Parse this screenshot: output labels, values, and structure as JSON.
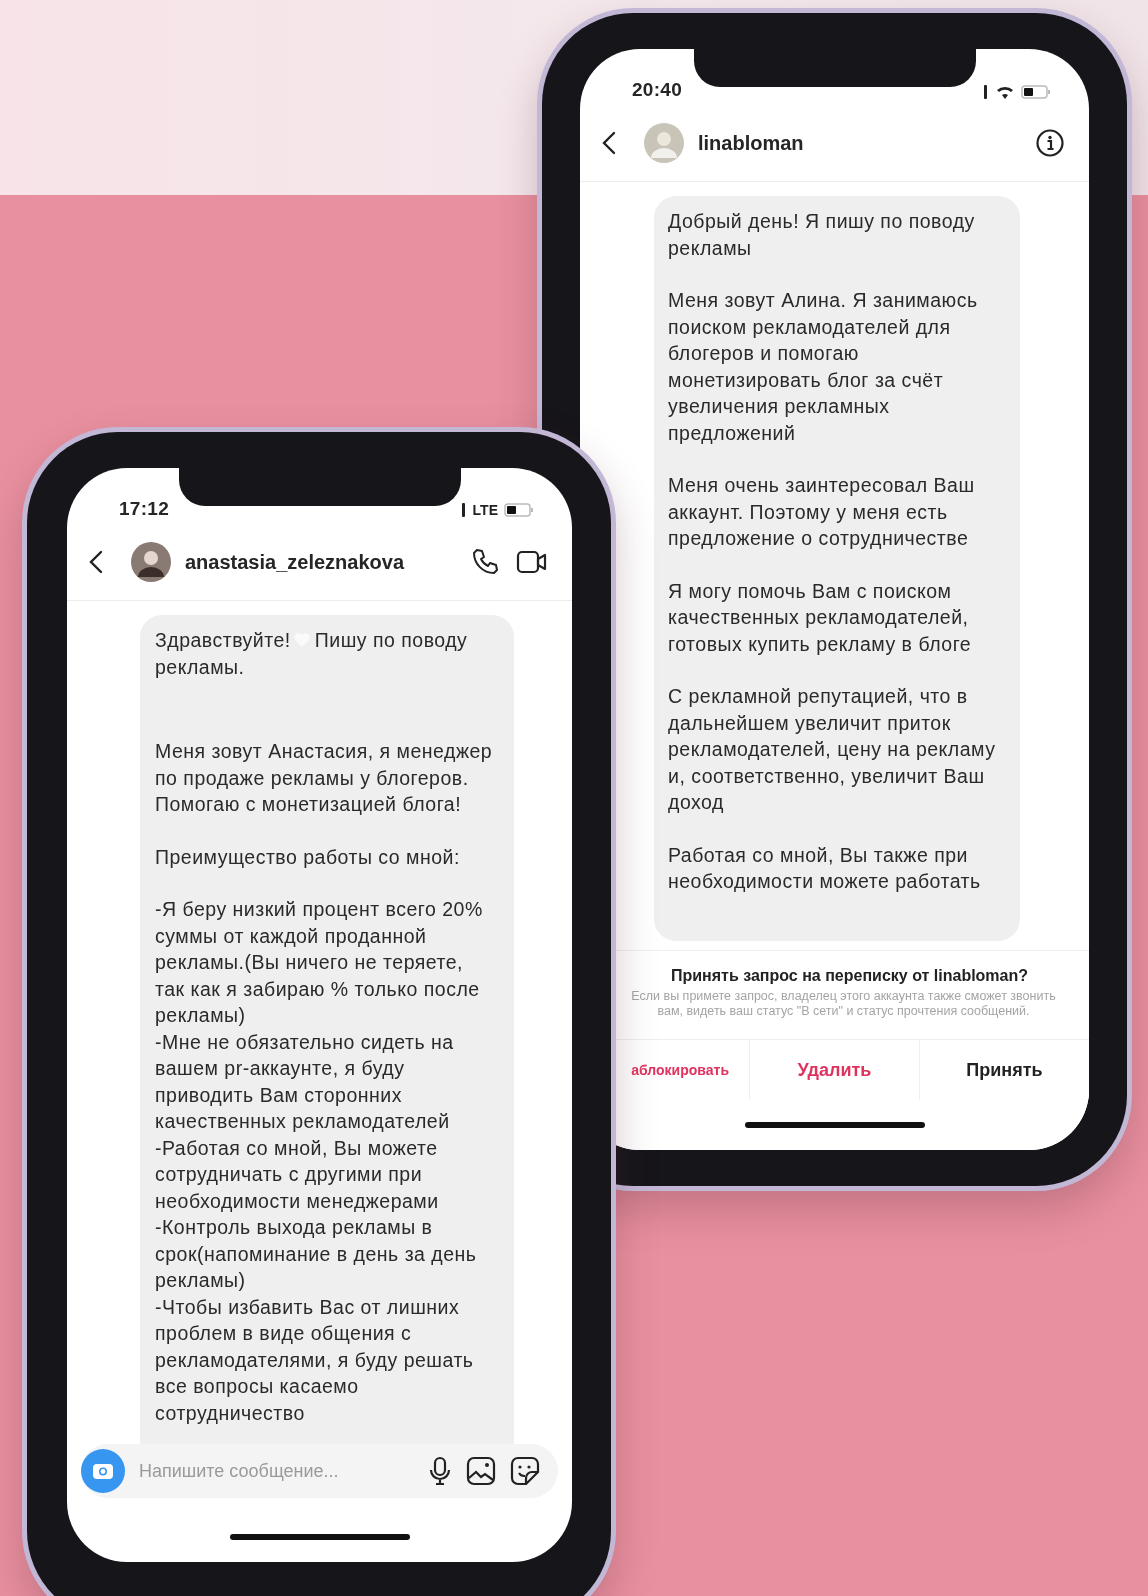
{
  "phone_back": {
    "status_bar": {
      "time": "20:40"
    },
    "header": {
      "username": "linabloman"
    },
    "message": {
      "paragraphs": [
        {
          "kind": "text",
          "text": "Добрый день! Я пишу по поводу рекламы"
        },
        {
          "kind": "text",
          "text": "Меня зовут Алина. Я занимаюсь поиском рекламодателей для блогеров и помогаю монетизировать блог за счёт увеличения рекламных предложений"
        },
        {
          "kind": "text",
          "text": "Меня очень заинтересовал Ваш аккаунт. Поэтому у меня есть предложение о сотрудничестве"
        },
        {
          "kind": "text",
          "text": "Я могу помочь Вам с поиском качественных рекламодателей, готовых купить рекламу в блоге"
        },
        {
          "kind": "text",
          "text": "С рекламной репутацией, что в дальнейшем увеличит приток рекламодателей, цену на рекламу и, соответственно, увеличит Ваш доход"
        },
        {
          "kind": "text",
          "text": "Работая со мной, Вы также при необходимости можете работать"
        }
      ]
    },
    "request_panel": {
      "title": "Принять запрос на переписку от linabloman?",
      "text": "Если вы примете запрос, владелец этого аккаунта также сможет звонить вам, видеть ваш статус \"В сети\" и статус прочтения сообщений.",
      "actions": [
        {
          "label": "аблокировать",
          "kind": "danger"
        },
        {
          "label": "Удалить",
          "kind": "danger"
        },
        {
          "label": "Принять",
          "kind": "normal"
        }
      ]
    }
  },
  "phone_front": {
    "status_bar": {
      "time": "17:12",
      "network": "LTE"
    },
    "header": {
      "username": "anastasia_zeleznakova"
    },
    "message": {
      "paragraphs": [
        {
          "kind": "icon_split",
          "before": "Здравствуйте!",
          "after": "Пишу по поводу",
          "continuation": "рекламы."
        },
        {
          "kind": "text",
          "text": "Меня зовут Анастасия, я менеджер по продаже рекламы у блогеров.\nПомогаю с монетизацией блога!"
        },
        {
          "kind": "text",
          "text": "Преимущество работы со мной:"
        },
        {
          "kind": "text",
          "text": "-Я беру низкий процент всего 20% суммы от каждой проданной рекламы.(Вы ничего не теряете, так как я забираю % только после рекламы)\n-Мне не обязательно сидеть на вашем pr-аккаунте, я буду приводить Вам сторонних качественных рекламодателей\n-Работая со мной, Вы можете сотрудничать с другими при необходимости менеджерами\n-Контроль выхода рекламы в срок(напоминание в день за день рекламы)\n-Чтобы избавить Вас от лишних проблем в виде общения с рекламодателями, я буду решать все вопросы касаемо\nсотрудничество"
        }
      ]
    },
    "composer": {
      "placeholder": "Напишите сообщение..."
    }
  }
}
